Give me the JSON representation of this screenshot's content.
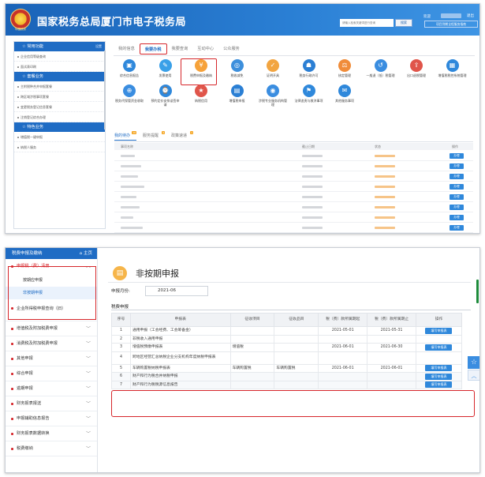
{
  "top": {
    "site_title": "国家税务总局厦门市电子税务局",
    "search_placeholder": "请输入检索关键词进行查询",
    "search_button": "搜索",
    "welcome": "欢迎",
    "logout": "退出",
    "header_button": "项目到期全程服务指南",
    "emblem_caption": "中国税务",
    "sidebar": {
      "sections": [
        {
          "title": "常用功能",
          "more": "设置",
          "items": [
            "企业信用等级查询",
            "面试表印刷"
          ]
        },
        {
          "title": "套餐业务",
          "items": [
            "主附税种合并申报套餐",
            "跨区域涉税事项套餐",
            "变更税务登记信息套餐",
            "注销登记综合办理"
          ]
        },
        {
          "title": "特色业务",
          "items": [
            "增值税一键申报",
            "纳税人服务"
          ]
        }
      ]
    },
    "tabs": [
      "我的信息",
      "我要办税",
      "我要查询",
      "互动中心",
      "公众服务"
    ],
    "active_tab": "我要办税",
    "grid_row1": [
      {
        "label": "综合信息报告",
        "icon": "info-report-icon",
        "color": "#2f88db"
      },
      {
        "label": "发票使用",
        "icon": "invoice-icon",
        "color": "#3aa0e8"
      },
      {
        "label": "税费申报及缴纳",
        "icon": "tax-declare-icon",
        "color": "#f6a23a"
      },
      {
        "label": "税收减免",
        "icon": "tax-reduction-icon",
        "color": "#3d8fdc"
      },
      {
        "label": "证明开具",
        "icon": "certificate-icon",
        "color": "#f2a541"
      },
      {
        "label": "税务行政许可",
        "icon": "admin-permit-icon",
        "color": "#2b7fd4"
      },
      {
        "label": "核定管理",
        "icon": "verify-icon",
        "color": "#f08c3a"
      },
      {
        "label": "一般退（抵）税管理",
        "icon": "refund-icon",
        "color": "#3a8de0"
      },
      {
        "label": "出口退税管理",
        "icon": "export-refund-icon",
        "color": "#e0554a"
      },
      {
        "label": "增值税税控系统管理",
        "icon": "tax-control-icon",
        "color": "#2f88db"
      }
    ],
    "grid_row2": [
      {
        "label": "税务代保管资金收取",
        "icon": "custody-fund-icon",
        "color": "#3a8de0"
      },
      {
        "label": "预约定价安排谈签申请",
        "icon": "pricing-icon",
        "color": "#2f88db"
      },
      {
        "label": "纳税信用",
        "icon": "credit-icon",
        "color": "#e0554a"
      },
      {
        "label": "增值税申报",
        "icon": "vat-icon",
        "color": "#2b7fd4"
      },
      {
        "label": "涉税专业服务机构管理",
        "icon": "agency-icon",
        "color": "#3a8de0"
      },
      {
        "label": "法律追责与救济事项",
        "icon": "law-icon",
        "color": "#2f88db"
      },
      {
        "label": "其他服务事项",
        "icon": "other-service-icon",
        "color": "#2f88db"
      }
    ],
    "task_tabs": [
      {
        "label": "我的待办",
        "badge": "10",
        "active": true
      },
      {
        "label": "服务提醒",
        "badge": "4",
        "active": false
      },
      {
        "label": "政策速递",
        "badge": "1",
        "active": false
      }
    ],
    "task_headers": [
      "事项名称",
      "截止日期",
      "状态",
      "操作"
    ],
    "task_action": "办理"
  },
  "bottom": {
    "sidebar_header": "税费申报及缴纳",
    "home_label": "主页",
    "menu": [
      {
        "label": "申报税（费）清册",
        "open": true,
        "children": [
          {
            "label": "按期应申报",
            "active": false
          },
          {
            "label": "非按期申报",
            "active": true
          }
        ]
      },
      {
        "label": "企业所得税申报查询（旧）",
        "two_line": true
      },
      {
        "label": "增值税及附加税费申报"
      },
      {
        "label": "消费税及附加税费申报"
      },
      {
        "label": "其他申报"
      },
      {
        "label": "综合申报"
      },
      {
        "label": "逾期申报"
      },
      {
        "label": "财务报表报送"
      },
      {
        "label": "申报辅助信息报告"
      },
      {
        "label": "财务报表数据转换"
      },
      {
        "label": "税费缴纳"
      }
    ],
    "page_title": "非按期申报",
    "month_label": "申报月份:",
    "month_value": "2021-06",
    "section_title": "税费申报",
    "table": {
      "headers": [
        "序号",
        "申报表",
        "征收项目",
        "征收品目",
        "税（费）款所属期起",
        "税（费）款所属期止",
        "操作"
      ],
      "rows": [
        {
          "no": "1",
          "form": "通用申报（工会经费、工会筹备金）",
          "item": "",
          "sub": "",
          "start": "2021-05-01",
          "end": "2021-05-31"
        },
        {
          "no": "2",
          "form": "非税收入通用申报",
          "item": "",
          "sub": "",
          "start": "",
          "end": ""
        },
        {
          "no": "3",
          "form": "增值税预缴申报表",
          "item": "增值税",
          "sub": "",
          "start": "2021-06-01",
          "end": "2021-06-30"
        },
        {
          "no": "4",
          "form": "跨地区经营汇总纳税企业分支机构年度纳税申报表",
          "item": "",
          "sub": "",
          "start": "",
          "end": ""
        },
        {
          "no": "5",
          "form": "车辆购置税纳税申报表",
          "item": "车辆购置税",
          "sub": "车辆购置税",
          "start": "2021-06-01",
          "end": "2021-06-01"
        },
        {
          "no": "6",
          "form": "财产和行为税合并纳税申报",
          "item": "",
          "sub": "",
          "start": "",
          "end": ""
        },
        {
          "no": "7",
          "form": "财产和行为税税源信息报告",
          "item": "",
          "sub": "",
          "start": "",
          "end": ""
        }
      ],
      "action_label": "填写申报表"
    }
  }
}
